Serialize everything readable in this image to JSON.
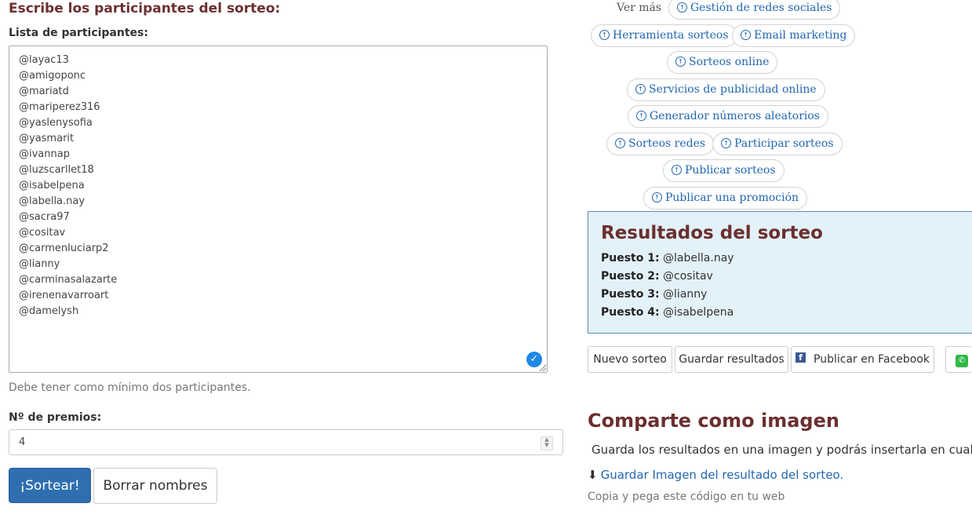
{
  "form": {
    "heading": "Escribe los participantes del sorteo:",
    "list_label": "Lista de participantes:",
    "participants": [
      "@layac13",
      "@amigoponc",
      "@mariatd",
      "@mariperez316",
      "@yaslenysofia",
      "@yasmarit",
      "@ivannap",
      "@luzscarllet18",
      "@isabelpena",
      "@labella.nay",
      "@sacra97",
      "@cositav",
      "@carmenluciarp2",
      "@lianny",
      "@carminasalazarte",
      "@irenenavarroart",
      "@damelysh"
    ],
    "help_text": "Debe tener como mínimo dos participantes.",
    "prizes_label": "Nº de premios:",
    "prizes_value": "4",
    "draw_button": "¡Sortear!",
    "clear_button": "Borrar nombres"
  },
  "links": {
    "ver_mas": "Ver más",
    "items": [
      "Gestión de redes sociales",
      "Herramienta sorteos",
      "Email marketing",
      "Sorteos online",
      "Servicios de publicidad online",
      "Generador números aleatorios",
      "Sorteos redes",
      "Participar sorteos",
      "Publicar sorteos",
      "Publicar una promoción"
    ]
  },
  "results": {
    "title": "Resultados del sorteo",
    "rows": [
      {
        "label": "Puesto 1:",
        "value": "@labella.nay"
      },
      {
        "label": "Puesto 2:",
        "value": "@cositav"
      },
      {
        "label": "Puesto 3:",
        "value": "@lianny"
      },
      {
        "label": "Puesto 4:",
        "value": "@isabelpena"
      }
    ]
  },
  "actions": {
    "new_draw": "Nuevo sorteo",
    "save_results": "Guardar resultados",
    "publish_facebook": "Publicar en Facebook"
  },
  "share": {
    "title": "Comparte como imagen",
    "description": "Guarda los resultados en una imagen y podrás insertarla en cualquier P",
    "download_link": "Guardar Imagen del resultado del sorteo.",
    "copy_text": "Copia y pega este código en tu web"
  }
}
